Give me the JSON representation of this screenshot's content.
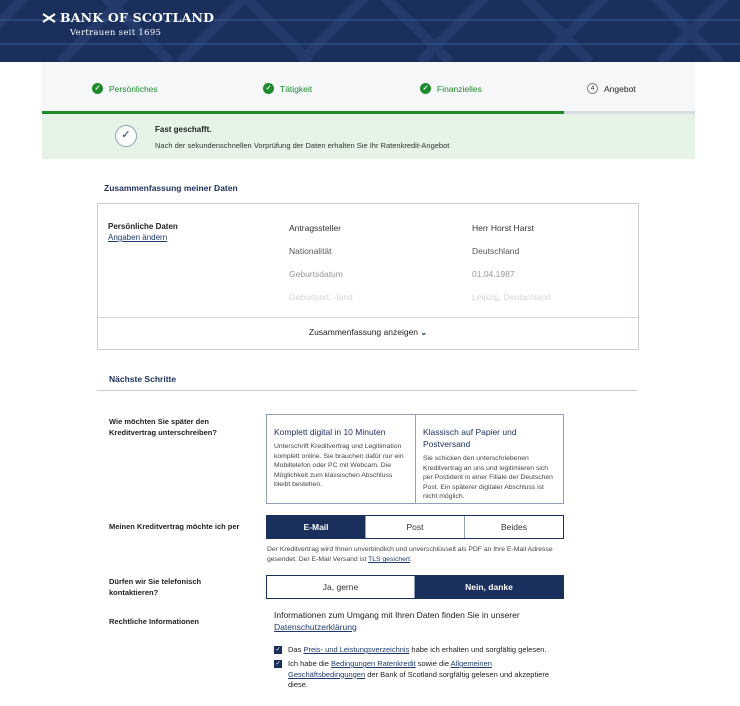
{
  "brand": {
    "name": "BANK OF SCOTLAND",
    "tagline": "Vertrauen seit 1695"
  },
  "steps": [
    {
      "label": "Persönliches",
      "state": "done"
    },
    {
      "label": "Tätigkeit",
      "state": "done"
    },
    {
      "label": "Finanzielles",
      "state": "done"
    },
    {
      "label": "Angebot",
      "state": "current",
      "number": "4"
    }
  ],
  "progress": {
    "completed_fraction": 0.8
  },
  "banner": {
    "title": "Fast geschafft.",
    "text": "Nach der sekundenschnellen Vorprüfung der Daten erhalten Sie Ihr Ratenkredit-Angebot"
  },
  "summary": {
    "title": "Zusammenfassung meiner Daten",
    "section_label": "Persönliche Daten",
    "edit_link": "Angaben ändern",
    "rows": [
      {
        "key": "Antragssteller",
        "value": "Herr Horst Harst"
      },
      {
        "key": "Nationalität",
        "value": "Deutschland"
      },
      {
        "key": "Geburtsdatum",
        "value": "01.04.1987"
      },
      {
        "key": "Geburtsort, -land",
        "value": "Leipzig, Deutschland"
      }
    ],
    "toggle_label": "Zusammenfassung anzeigen",
    "toggle_icon": "chevron-down-icon"
  },
  "next_steps": {
    "title": "Nächste Schritte",
    "sign_question": "Wie möchten Sie später den Kreditvertrag unterschreiben?",
    "sign_options": [
      {
        "title": "Komplett digital in 10 Minuten",
        "text": "Unterschrift Kreditvertrag und Legitimation komplett online. Sie brauchen dafür nur ein Mobiltelefon oder PC mit Webcam. Die Möglichkeit zum klassischen Abschluss bleibt bestehen."
      },
      {
        "title": "Klassisch auf Papier und Postversand",
        "text": "Sie schicken den unterschriebenen Kreditvertrag an uns und legitimieren sich per Postident in einer Filiale der Deutschen Post. Ein späterer digitaler Abschluss ist nicht möglich."
      }
    ],
    "delivery_question": "Meinen Kreditvertrag möchte ich per",
    "delivery_options": [
      "E-Mail",
      "Post",
      "Beides"
    ],
    "delivery_selected": "E-Mail",
    "delivery_hint": "Der Kreditvertrag wird Ihnen unverbindlich und unverschlüsselt als PDF an Ihre E-Mail Adresse gesendet. Der E-Mail Versand ist",
    "delivery_hint_link": "TLS gesichert",
    "delivery_hint_end": ".",
    "phone_question": "Dürfen wir Sie telefonisch kontaktieren?",
    "phone_options": [
      "Ja, gerne",
      "Nein, danke"
    ],
    "phone_selected": "Nein, danke",
    "legal_question": "Rechtliche Informationen",
    "legal_text": "Informationen zum Umgang mit Ihren Daten finden Sie in unserer",
    "legal_link": "Datenschutzerklärung",
    "consents": [
      {
        "checked": true,
        "pre": "Das",
        "link": "Preis- und Leistungsverzeichnis",
        "post": "habe ich erhalten und sorgfältig gelesen."
      },
      {
        "checked": true,
        "pre": "Ich habe die",
        "link": "Bedingungen Ratenkredit",
        "mid": "sowie die",
        "link2": "Allgemeinen Geschäftsbedingungen",
        "post": "der Bank of Scotland sorgfältig gelesen und akzeptiere diese."
      }
    ]
  },
  "colors": {
    "navy": "#1b2f5c",
    "success_green": "#1d8a2c",
    "banner_bg": "#e5f4e6"
  }
}
